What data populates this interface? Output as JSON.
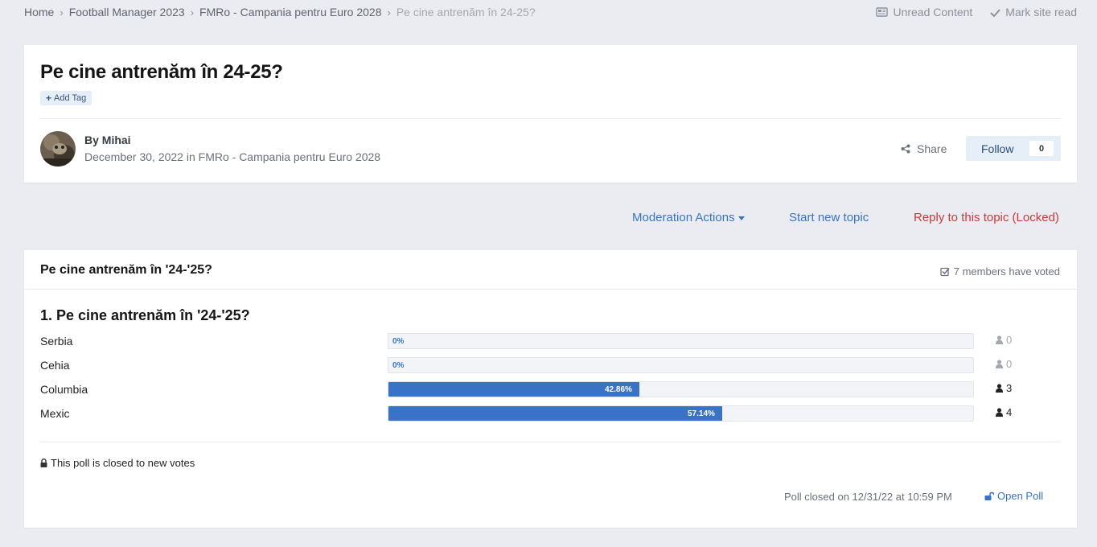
{
  "breadcrumb": [
    {
      "label": "Home"
    },
    {
      "label": "Football Manager 2023"
    },
    {
      "label": "FMRo - Campania pentru Euro 2028"
    },
    {
      "label": "Pe cine antrenăm în 24-25?"
    }
  ],
  "top_actions": {
    "unread": "Unread Content",
    "mark_read": "Mark site read"
  },
  "topic": {
    "title": "Pe cine antrenăm în 24-25?",
    "add_tag": "Add Tag",
    "author_line": "By Mihai",
    "meta": "December 30, 2022 in FMRo - Campania pentru Euro 2028",
    "share": "Share",
    "follow": "Follow",
    "follow_count": "0"
  },
  "actions": {
    "moderation": "Moderation Actions",
    "new_topic": "Start new topic",
    "reply": "Reply to this topic (Locked)"
  },
  "poll": {
    "title": "Pe cine antrenăm în '24-'25?",
    "voted": "7 members have voted",
    "question": "1. Pe cine antrenăm în '24-'25?",
    "options": [
      {
        "label": "Serbia",
        "percent": 0,
        "percent_label": "0%",
        "votes": "0"
      },
      {
        "label": "Cehia",
        "percent": 0,
        "percent_label": "0%",
        "votes": "0"
      },
      {
        "label": "Columbia",
        "percent": 42.86,
        "percent_label": "42.86%",
        "votes": "3"
      },
      {
        "label": "Mexic",
        "percent": 57.14,
        "percent_label": "57.14%",
        "votes": "4"
      }
    ],
    "closed_notice": "This poll is closed to new votes",
    "closed_on": "Poll closed on 12/31/22 at 10:59 PM",
    "open_poll": "Open Poll"
  },
  "colors": {
    "accent": "#3873c6",
    "locked": "#c73a3a",
    "background": "#ebecf1"
  }
}
